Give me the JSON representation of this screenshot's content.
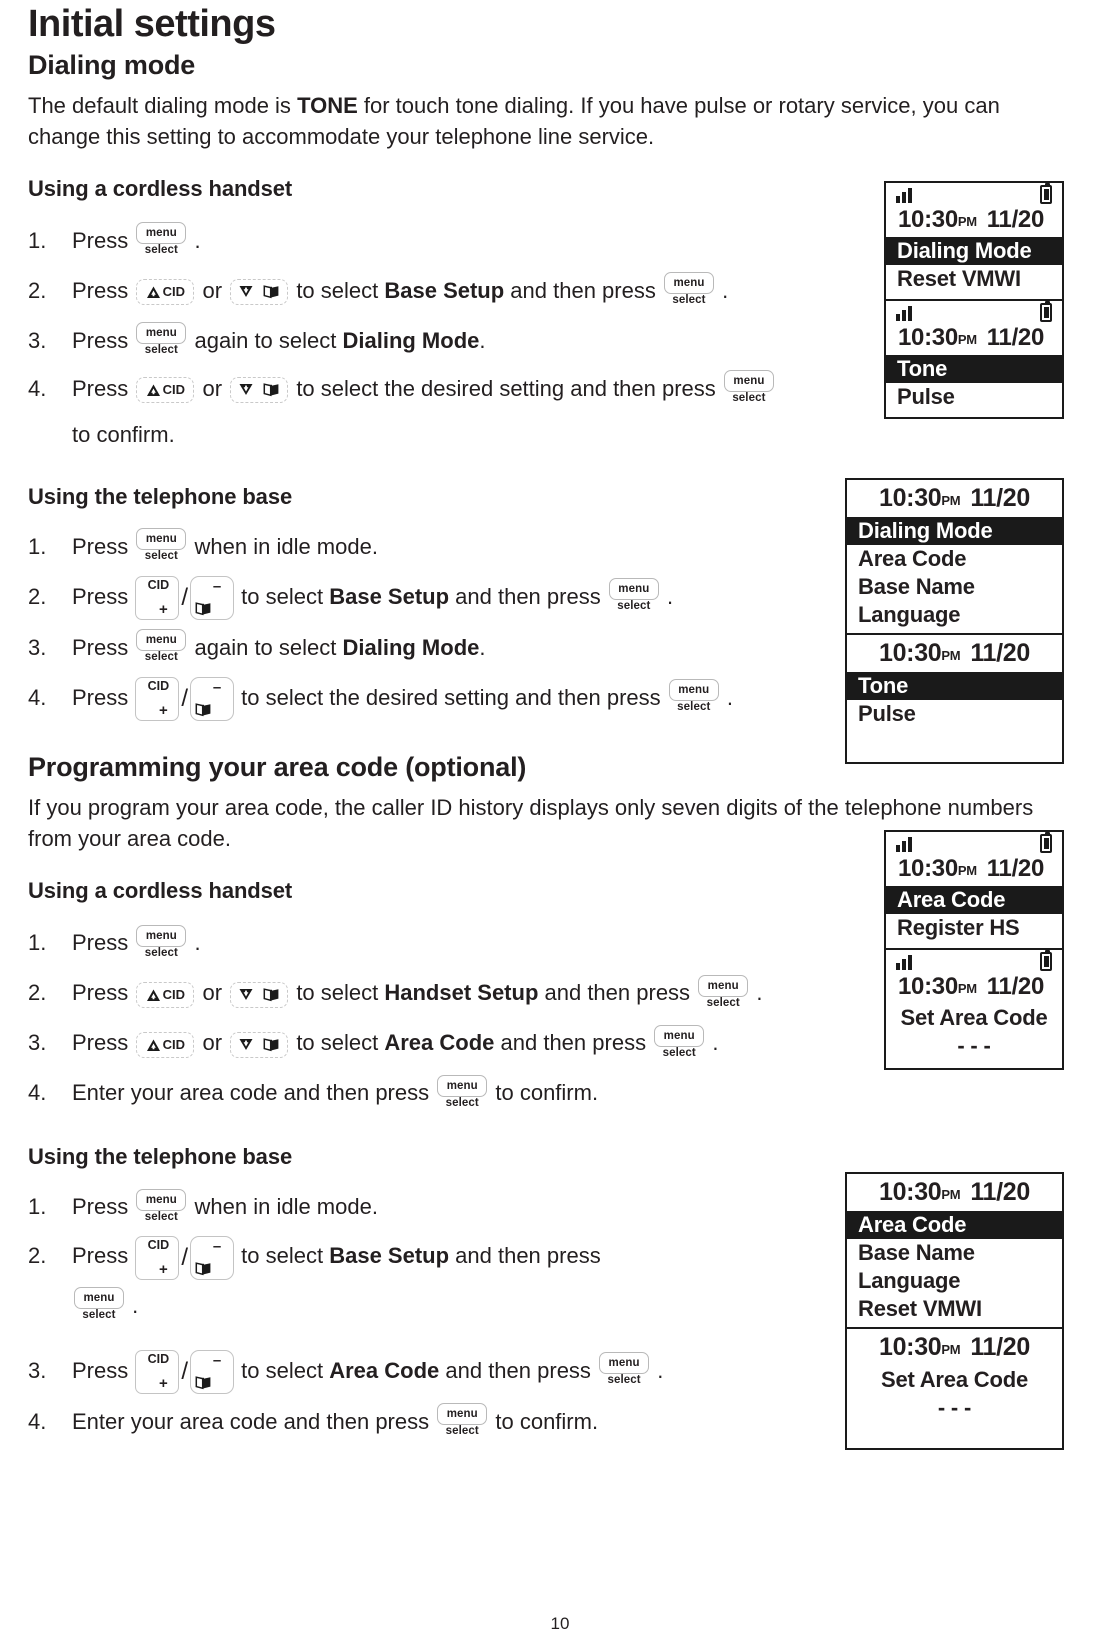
{
  "page": {
    "title": "Initial settings",
    "page_number": "10"
  },
  "dialing_mode": {
    "heading": "Dialing mode",
    "intro_part1": "The default dialing mode is ",
    "intro_bold": "TONE",
    "intro_part2": " for touch tone dialing. If you have pulse or rotary service, you can change this setting to accommodate your telephone line service.",
    "handset_heading": "Using a cordless handset",
    "handset_steps": [
      {
        "num": "1.",
        "pre": "Press",
        "post": "."
      },
      {
        "num": "2.",
        "pre": "Press",
        "mid": "or",
        "post_a": "to select ",
        "bold": "Base Setup",
        "post_b": " and then press",
        "tail": "."
      },
      {
        "num": "3.",
        "pre": "Press",
        "post_a": "again to select ",
        "bold": "Dialing Mode",
        "tail": "."
      },
      {
        "num": "4.",
        "pre": "Press",
        "mid": "or",
        "post_a": "to select the desired setting and then press",
        "tail": "to confirm."
      }
    ],
    "base_heading": "Using the telephone base",
    "base_steps": [
      {
        "num": "1.",
        "pre": "Press",
        "post": "when in idle mode."
      },
      {
        "num": "2.",
        "pre": "Press",
        "post_a": "to select ",
        "bold": "Base Setup",
        "post_b": " and then press",
        "tail": "."
      },
      {
        "num": "3.",
        "pre": "Press",
        "post_a": "again to select ",
        "bold": "Dialing Mode",
        "tail": "."
      },
      {
        "num": "4.",
        "pre": "Press",
        "post_a": "to select the desired setting and then press",
        "tail": "."
      }
    ]
  },
  "area_code": {
    "heading": "Programming your area code (optional)",
    "intro": "If you program your area code, the caller ID history displays only seven digits of the telephone numbers from your area code.",
    "handset_heading": "Using a cordless handset",
    "handset_steps": [
      {
        "num": "1.",
        "pre": "Press",
        "post": "."
      },
      {
        "num": "2.",
        "pre": "Press",
        "mid": "or",
        "post_a": "to select ",
        "bold": "Handset Setup",
        "post_b": " and then press",
        "tail": "."
      },
      {
        "num": "3.",
        "pre": "Press",
        "mid": "or",
        "post_a": "to select ",
        "bold": "Area Code",
        "post_b": " and then press",
        "tail": "."
      },
      {
        "num": "4.",
        "pre": "Enter your area code and then press",
        "tail": "to confirm."
      }
    ],
    "base_heading": "Using the telephone base",
    "base_steps": [
      {
        "num": "1.",
        "pre": "Press",
        "post": "when in idle mode."
      },
      {
        "num": "2.",
        "pre": "Press",
        "post_a": "to select ",
        "bold": "Base Setup",
        "post_b": " and then press",
        "tail": "."
      },
      {
        "num": "3.",
        "pre": "Press",
        "post_a": "to select ",
        "bold": "Area Code",
        "post_b": " and then press",
        "tail": "."
      },
      {
        "num": "4.",
        "pre": "Enter your area code and then press",
        "tail": "to confirm."
      }
    ]
  },
  "keys": {
    "menu": "menu",
    "select": "select",
    "cid": "CID",
    "plus": "+",
    "minus": "–",
    "slash": "/"
  },
  "lcd": {
    "handset_dialing": {
      "time": "10:30",
      "ampm": "PM",
      "date": "11/20",
      "screen1": [
        {
          "text": "Dialing Mode",
          "inverted": true
        },
        {
          "text": "Reset VMWI",
          "inverted": false
        }
      ],
      "screen2": [
        {
          "text": "Tone",
          "inverted": true
        },
        {
          "text": "Pulse",
          "inverted": false
        }
      ]
    },
    "base_dialing": {
      "time": "10:30",
      "ampm": "PM",
      "date": "11/20",
      "screen1": [
        {
          "text": "Dialing Mode",
          "inverted": true
        },
        {
          "text": "Area Code",
          "inverted": false
        },
        {
          "text": "Base Name",
          "inverted": false
        },
        {
          "text": "Language",
          "inverted": false
        }
      ],
      "screen2": [
        {
          "text": "Tone",
          "inverted": true
        },
        {
          "text": "Pulse",
          "inverted": false
        }
      ]
    },
    "handset_area": {
      "time": "10:30",
      "ampm": "PM",
      "date": "11/20",
      "screen1": [
        {
          "text": "Area Code",
          "inverted": true
        },
        {
          "text": "Register HS",
          "inverted": false
        }
      ],
      "screen2": [
        {
          "text": "Set Area Code",
          "inverted": false,
          "center": true
        },
        {
          "text": "- - -",
          "inverted": false,
          "center": true
        }
      ]
    },
    "base_area": {
      "time": "10:30",
      "ampm": "PM",
      "date": "11/20",
      "screen1": [
        {
          "text": "Area Code",
          "inverted": true
        },
        {
          "text": "Base Name",
          "inverted": false
        },
        {
          "text": "Language",
          "inverted": false
        },
        {
          "text": "Reset VMWI",
          "inverted": false
        }
      ],
      "screen2": [
        {
          "text": "Set Area Code",
          "inverted": false,
          "center": true
        },
        {
          "text": "- - -",
          "inverted": false,
          "center": true
        }
      ]
    }
  },
  "colors": {
    "ink": "#231f20",
    "lcd_border": "#1a1a1a",
    "lcd_highlight_bg": "#1a1a1a",
    "lcd_highlight_fg": "#ffffff",
    "key_outline": "#c4c4c4"
  }
}
